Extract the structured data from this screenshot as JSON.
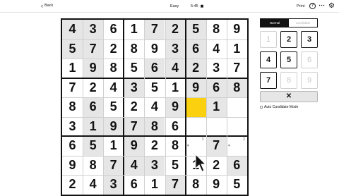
{
  "topbar": {
    "back_label": "Back",
    "difficulty": "Easy",
    "timer": "5:45",
    "print_label": "Print",
    "help_icon_label": "?",
    "more_icon": "⋯",
    "settings_icon": "⚙"
  },
  "mode": {
    "normal": "Normal",
    "candidate": "Candidate"
  },
  "keypad": [
    {
      "label": "1",
      "state": "off"
    },
    {
      "label": "2",
      "state": "on"
    },
    {
      "label": "3",
      "state": "on"
    },
    {
      "label": "4",
      "state": "on"
    },
    {
      "label": "5",
      "state": "on"
    },
    {
      "label": "6",
      "state": "off"
    },
    {
      "label": "7",
      "state": "on"
    },
    {
      "label": "8",
      "state": "off"
    },
    {
      "label": "9",
      "state": "off"
    }
  ],
  "delete_label": "✕",
  "auto_candidate_label": "Auto Candidate Mode",
  "colors": {
    "given_bg": "#e6e6e6",
    "selected": "#fbd00e",
    "accent": "#121212"
  },
  "grid": [
    [
      {
        "v": "4",
        "g": true
      },
      {
        "v": "3",
        "g": true
      },
      {
        "v": "6",
        "g": false
      },
      {
        "v": "1",
        "g": false
      },
      {
        "v": "7",
        "g": true
      },
      {
        "v": "2",
        "g": true
      },
      {
        "v": "5",
        "g": true
      },
      {
        "v": "8",
        "g": false
      },
      {
        "v": "9",
        "g": false
      }
    ],
    [
      {
        "v": "5",
        "g": true
      },
      {
        "v": "7",
        "g": true
      },
      {
        "v": "2",
        "g": false
      },
      {
        "v": "8",
        "g": false
      },
      {
        "v": "9",
        "g": false
      },
      {
        "v": "3",
        "g": true
      },
      {
        "v": "6",
        "g": true
      },
      {
        "v": "4",
        "g": false
      },
      {
        "v": "1",
        "g": false
      }
    ],
    [
      {
        "v": "1",
        "g": false
      },
      {
        "v": "9",
        "g": true
      },
      {
        "v": "8",
        "g": false
      },
      {
        "v": "5",
        "g": false
      },
      {
        "v": "6",
        "g": true
      },
      {
        "v": "4",
        "g": true
      },
      {
        "v": "2",
        "g": true
      },
      {
        "v": "3",
        "g": false
      },
      {
        "v": "7",
        "g": false
      }
    ],
    [
      {
        "v": "7",
        "g": false
      },
      {
        "v": "2",
        "g": false
      },
      {
        "v": "4",
        "g": false
      },
      {
        "v": "3",
        "g": true
      },
      {
        "v": "5",
        "g": false
      },
      {
        "v": "1",
        "g": false
      },
      {
        "v": "9",
        "g": true
      },
      {
        "v": "6",
        "g": true
      },
      {
        "v": "8",
        "g": true
      }
    ],
    [
      {
        "v": "8",
        "g": false
      },
      {
        "v": "6",
        "g": true
      },
      {
        "v": "5",
        "g": false
      },
      {
        "v": "2",
        "g": false
      },
      {
        "v": "4",
        "g": false
      },
      {
        "v": "9",
        "g": true
      },
      {
        "v": "",
        "g": false,
        "sel": true
      },
      {
        "v": "1",
        "g": true
      },
      {
        "v": "",
        "g": false
      }
    ],
    [
      {
        "v": "3",
        "g": false
      },
      {
        "v": "1",
        "g": true
      },
      {
        "v": "9",
        "g": true
      },
      {
        "v": "7",
        "g": true
      },
      {
        "v": "8",
        "g": true
      },
      {
        "v": "6",
        "g": false
      },
      {
        "v": "",
        "g": false
      },
      {
        "v": "",
        "g": false
      },
      {
        "v": "",
        "g": false
      }
    ],
    [
      {
        "v": "6",
        "g": false
      },
      {
        "v": "5",
        "g": true
      },
      {
        "v": "1",
        "g": false
      },
      {
        "v": "9",
        "g": true
      },
      {
        "v": "2",
        "g": false
      },
      {
        "v": "8",
        "g": false
      },
      {
        "v": "",
        "g": false,
        "c": [
          "4",
          "3"
        ]
      },
      {
        "v": "7",
        "g": true
      },
      {
        "v": "",
        "g": false,
        "c": [
          "4",
          "3"
        ]
      }
    ],
    [
      {
        "v": "9",
        "g": false
      },
      {
        "v": "8",
        "g": false
      },
      {
        "v": "7",
        "g": true
      },
      {
        "v": "4",
        "g": true
      },
      {
        "v": "3",
        "g": true
      },
      {
        "v": "5",
        "g": false
      },
      {
        "v": "1",
        "g": false
      },
      {
        "v": "2",
        "g": false
      },
      {
        "v": "6",
        "g": true
      }
    ],
    [
      {
        "v": "2",
        "g": false
      },
      {
        "v": "4",
        "g": false
      },
      {
        "v": "3",
        "g": true
      },
      {
        "v": "6",
        "g": false
      },
      {
        "v": "1",
        "g": false
      },
      {
        "v": "7",
        "g": true
      },
      {
        "v": "8",
        "g": false
      },
      {
        "v": "9",
        "g": false
      },
      {
        "v": "5",
        "g": false
      }
    ]
  ]
}
